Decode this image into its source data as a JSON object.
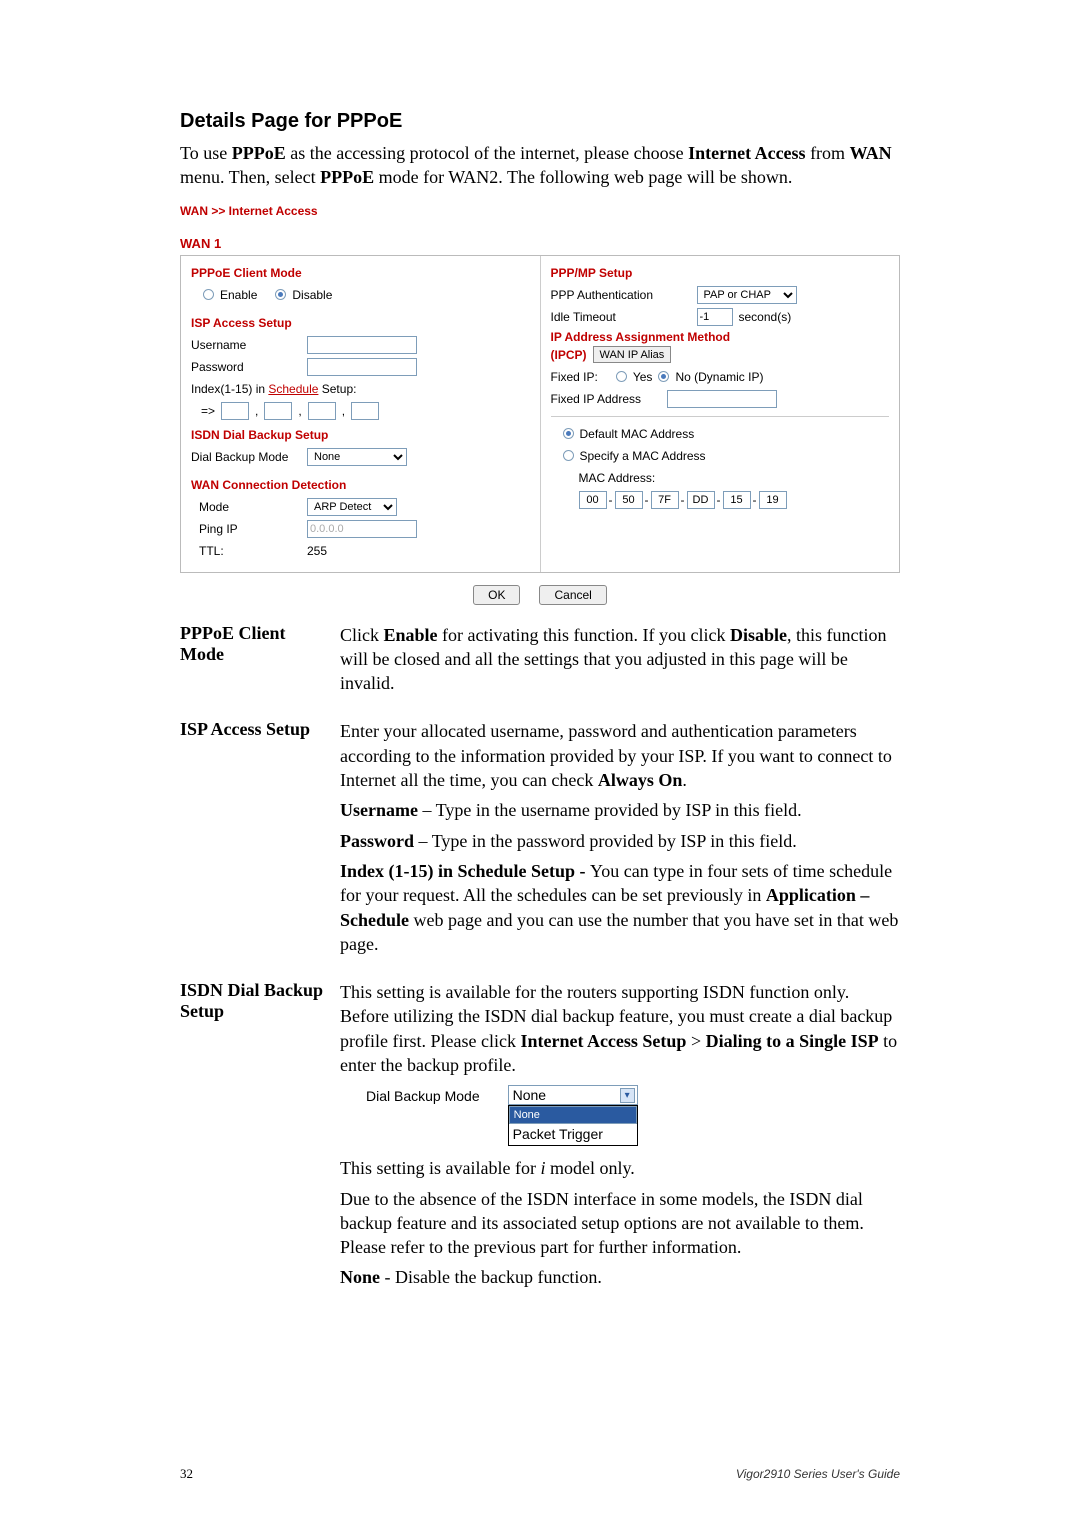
{
  "title": "Details Page for PPPoE",
  "intro": {
    "t1": "To use ",
    "b1": "PPPoE",
    "t2": " as the accessing protocol of the internet, please choose ",
    "b2": "Internet Access",
    "t3": " from ",
    "b3": "WAN",
    "t4": " menu. Then, select ",
    "b4": "PPPoE",
    "t5": " mode for WAN2. The following web page will be shown."
  },
  "breadcrumb": "WAN >> Internet Access",
  "wan_label": "WAN 1",
  "panel": {
    "left": {
      "client_mode_h": "PPPoE Client Mode",
      "enable": "Enable",
      "disable": "Disable",
      "isp_h": "ISP Access Setup",
      "username": "Username",
      "password": "Password",
      "index_pre": "Index(1-15) in ",
      "index_link": "Schedule",
      "index_post": " Setup:",
      "arrow": "=>",
      "isdn_h": "ISDN Dial Backup Setup",
      "dial_label": "Dial Backup Mode",
      "dial_value": "None",
      "wan_h": "WAN Connection Detection",
      "mode_l": "Mode",
      "mode_v": "ARP Detect",
      "ping_l": "Ping IP",
      "ping_v": "0.0.0.0",
      "ttl_l": "TTL:",
      "ttl_v": "255"
    },
    "right": {
      "ppp_h": "PPP/MP Setup",
      "auth_l": "PPP Authentication",
      "auth_v": "PAP or CHAP",
      "idle_l": "Idle Timeout",
      "idle_v": "-1",
      "idle_unit": "second(s)",
      "ipcp_h_pre": "IP Address Assignment Method",
      "ipcp_h_label": "(IPCP)",
      "wanip_btn": "WAN IP Alias",
      "fixed_l": "Fixed IP:",
      "yes": "Yes",
      "no": "No (Dynamic IP)",
      "fixedaddr_l": "Fixed IP Address",
      "mac_default": "Default MAC Address",
      "mac_specify": "Specify a MAC Address",
      "mac_l": "MAC Address:",
      "mac": [
        "00",
        "50",
        "7F",
        "DD",
        "15",
        "19"
      ]
    },
    "ok": "OK",
    "cancel": "Cancel"
  },
  "defs": {
    "pppoe_term": "PPPoE Client Mode",
    "pppoe_body": {
      "t1": "Click ",
      "b1": "Enable",
      "t2": " for activating this function. If you click ",
      "b2": "Disable",
      "t3": ", this function will be closed and all the settings that you adjusted in this page will be invalid."
    },
    "isp_term": "ISP Access Setup",
    "isp_body": {
      "p1_t1": "Enter your allocated username, password and authentication parameters according to the information provided by your ISP. If you want to connect to Internet all the time, you can check ",
      "p1_b1": "Always On",
      "p1_t2": ".",
      "p2_b1": "Username",
      "p2_t1": " – Type in the username provided by ISP in this field.",
      "p3_b1": "Password",
      "p3_t1": " – Type in the password provided by ISP in this field.",
      "p4_b1": "Index (1-15) in Schedule Setup - ",
      "p4_t1": "You can type in four sets of time schedule for your request. All the schedules can be set previously in ",
      "p4_b2": "Application – Schedule",
      "p4_t2": " web page and you can use the number that you have set in that web page."
    },
    "isdn_term": "ISDN Dial Backup Setup",
    "isdn_body": {
      "p1_t1": "This setting is available for the routers supporting ISDN function only. Before utilizing the ISDN dial backup feature, you must create a dial backup profile first. Please click ",
      "p1_b1": "Internet Access Setup",
      "p1_t2": " > ",
      "p1_b2": "Dialing to a Single ISP",
      "p1_t3": " to enter the backup profile.",
      "dd_label": "Dial Backup Mode",
      "dd_selected": "None",
      "dd_items": [
        "None",
        "Packet Trigger"
      ],
      "p2_t1": "This setting is available for ",
      "p2_i1": "i",
      "p2_t2": " model only.",
      "p3_t1": "Due to the absence of the ISDN interface in some models, the ISDN dial backup feature and its associated setup options are not available to them. Please refer to the previous part for further information.",
      "p4_b1": "None",
      "p4_t1": " - Disable the backup function."
    }
  },
  "footer": {
    "page": "32",
    "guide": "Vigor2910  Series  User's Guide"
  }
}
